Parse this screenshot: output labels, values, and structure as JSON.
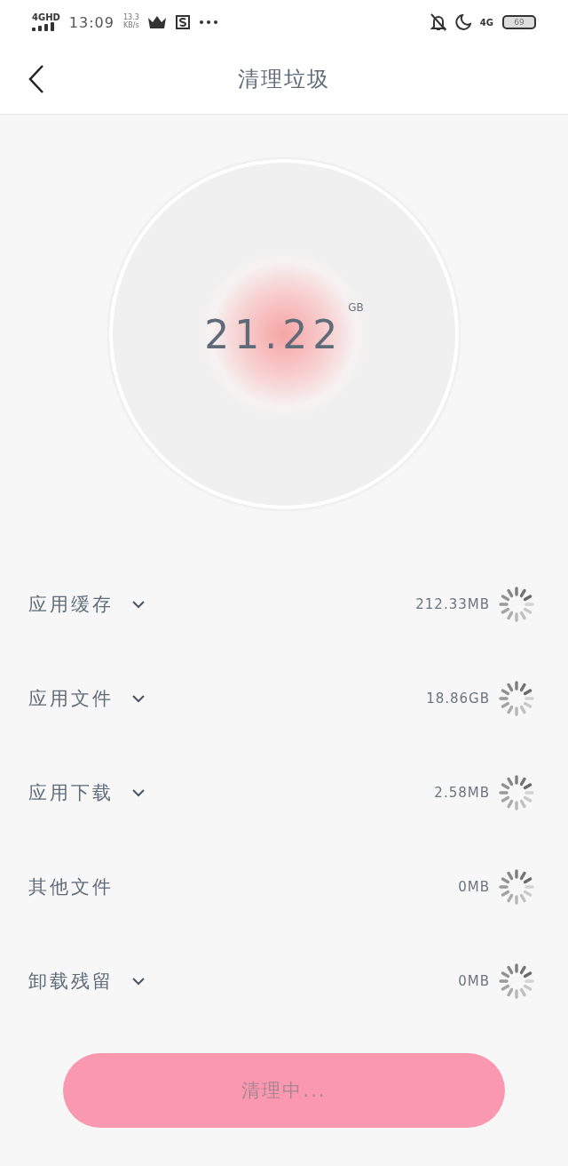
{
  "status_bar": {
    "network": "4GHD",
    "time": "13:09",
    "speed": "13.3",
    "speed_unit": "KB/s",
    "network_right": "4G",
    "battery": "69"
  },
  "header": {
    "title": "清理垃圾"
  },
  "total": {
    "value": "21.22",
    "unit": "GB"
  },
  "items": [
    {
      "label": "应用缓存",
      "expandable": true,
      "size": "212.33MB"
    },
    {
      "label": "应用文件",
      "expandable": true,
      "size": "18.86GB"
    },
    {
      "label": "应用下载",
      "expandable": true,
      "size": "2.58MB"
    },
    {
      "label": "其他文件",
      "expandable": false,
      "size": "0MB"
    },
    {
      "label": "卸载残留",
      "expandable": true,
      "size": "0MB"
    }
  ],
  "button": {
    "label": "清理中..."
  }
}
